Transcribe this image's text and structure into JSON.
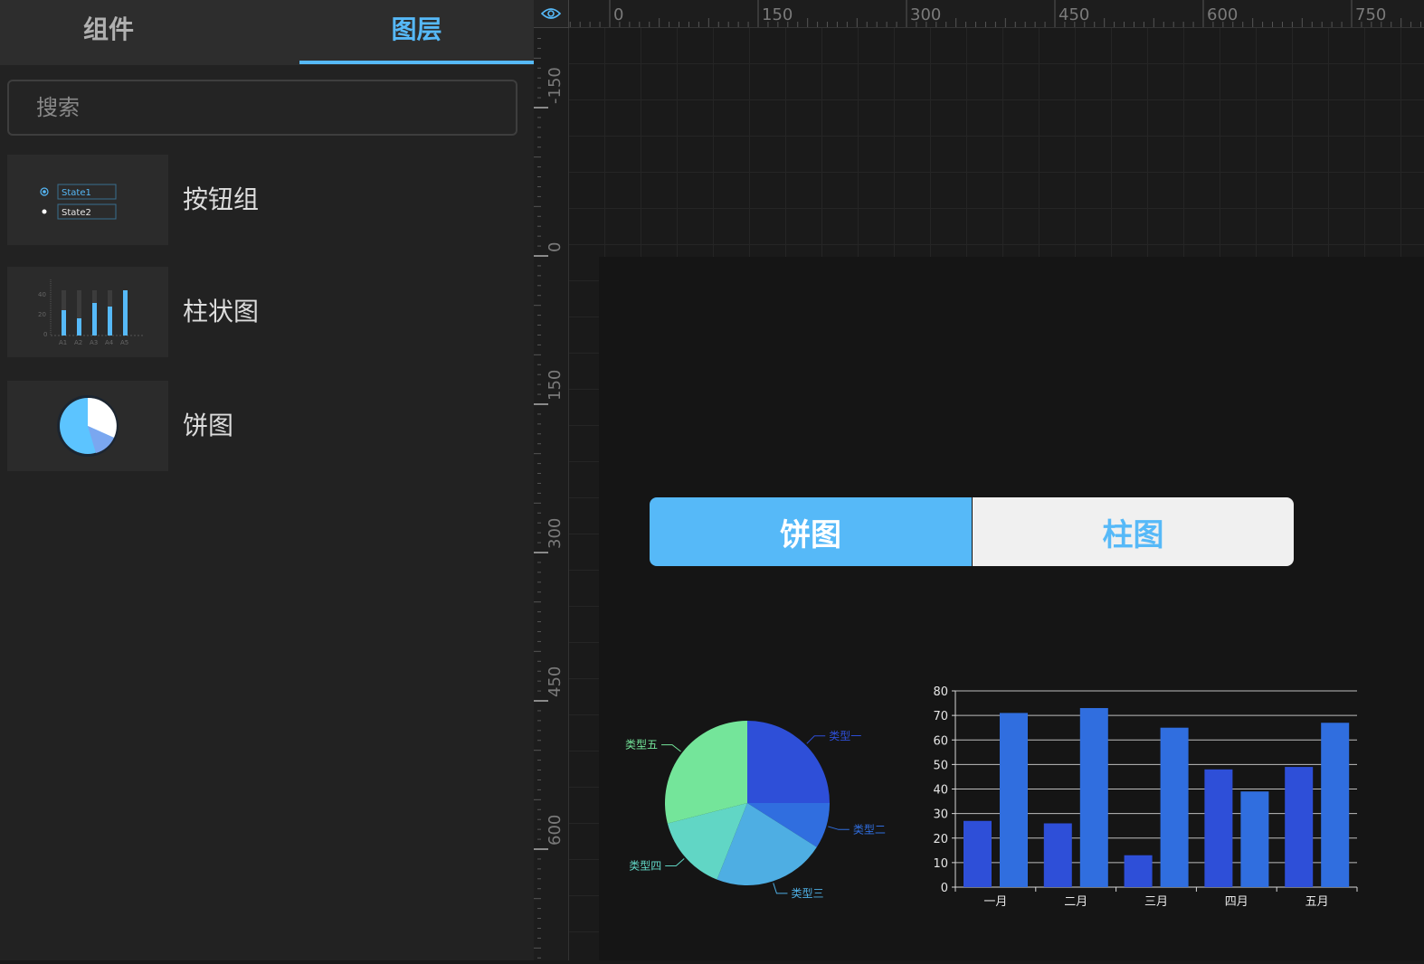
{
  "left_panel": {
    "tabs": [
      {
        "label": "组件",
        "active": false
      },
      {
        "label": "图层",
        "active": true
      }
    ],
    "search": {
      "placeholder": "搜索",
      "value": ""
    },
    "items": [
      {
        "label": "按钮组",
        "thumb_states": [
          "State1",
          "State2"
        ]
      },
      {
        "label": "柱状图",
        "thumb_yticks": [
          "40",
          "20",
          "0"
        ],
        "thumb_xticks": [
          "A1",
          "A2",
          "A3",
          "A4",
          "A5"
        ]
      },
      {
        "label": "饼图"
      }
    ]
  },
  "ruler": {
    "top": [
      "0",
      "150",
      "300",
      "450",
      "600",
      "750"
    ],
    "left": [
      "-150",
      "0",
      "150",
      "300",
      "450",
      "600"
    ]
  },
  "icons": {
    "visibility": "eye-icon"
  },
  "canvas": {
    "toggle": {
      "pie_label": "饼图",
      "bar_label": "柱图",
      "active": "pie"
    }
  },
  "colors": {
    "accent": "#56b9f8",
    "panel_bg": "#222222",
    "stage_bg": "#151515"
  },
  "chart_data": [
    {
      "type": "pie",
      "labels": [
        "类型一",
        "类型二",
        "类型三",
        "类型四",
        "类型五"
      ],
      "values": [
        25,
        9,
        22,
        15,
        29
      ],
      "colors": [
        "#2e4fd8",
        "#306edf",
        "#4eaee3",
        "#61d6c5",
        "#74e59a"
      ]
    },
    {
      "type": "bar",
      "categories": [
        "一月",
        "二月",
        "三月",
        "四月",
        "五月"
      ],
      "series": [
        {
          "values": [
            27,
            26,
            13,
            48,
            49
          ],
          "color": "#2e4fd8"
        },
        {
          "values": [
            71,
            73,
            65,
            39,
            67
          ],
          "color": "#306edf"
        }
      ],
      "ylim": [
        0,
        80
      ],
      "yticks": [
        "0",
        "10",
        "20",
        "30",
        "40",
        "50",
        "60",
        "70",
        "80"
      ],
      "grid": true
    }
  ]
}
